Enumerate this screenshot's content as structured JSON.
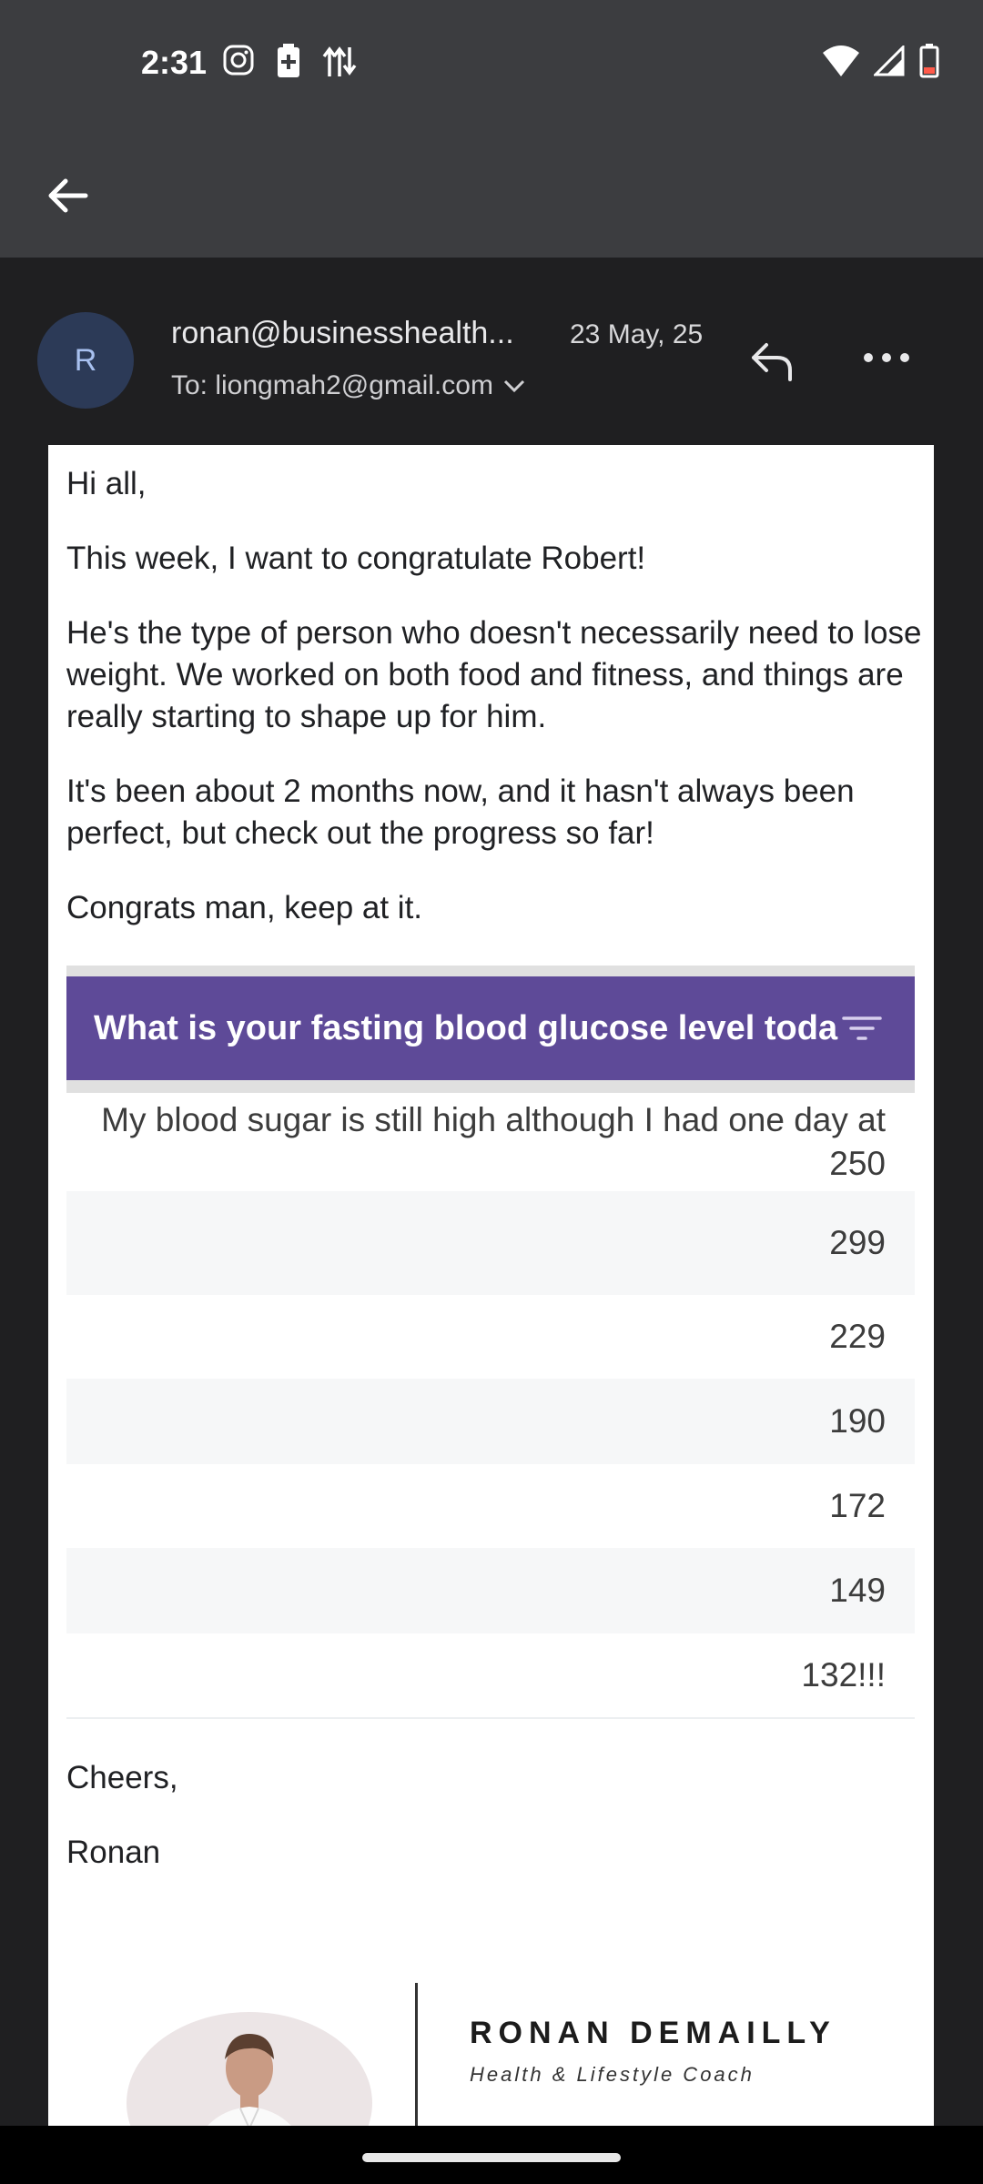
{
  "status_bar": {
    "time": "2:31"
  },
  "email": {
    "avatar_letter": "R",
    "sender": "ronan@businesshealth...",
    "date": "23 May, 25",
    "to": "To: liongmah2@gmail.com",
    "paragraphs": [
      "Hi all,",
      "This week, I want to congratulate Robert!",
      "He's the type of person who doesn't necessarily need to lose weight. We worked on both food and fitness, and things are really starting to shape up for him.",
      "It's been about 2 months now, and it hasn't always been perfect, but check out the progress so far!",
      "Congrats man, keep at it."
    ],
    "table": {
      "header": "What is your fasting blood glucose level toda",
      "rows": [
        "My blood sugar is still high although I had one day at 250",
        "299",
        "229",
        "190",
        "172",
        "149",
        "132!!!"
      ]
    },
    "closing": [
      "Cheers,",
      "Ronan"
    ],
    "signature": {
      "name": "RONAN DEMAILLY",
      "title": "Health & Lifestyle Coach"
    }
  },
  "colors": {
    "table_header": "#5e4a98",
    "avatar_bg": "#2c3a57",
    "app_bar": "#3c3d40"
  }
}
